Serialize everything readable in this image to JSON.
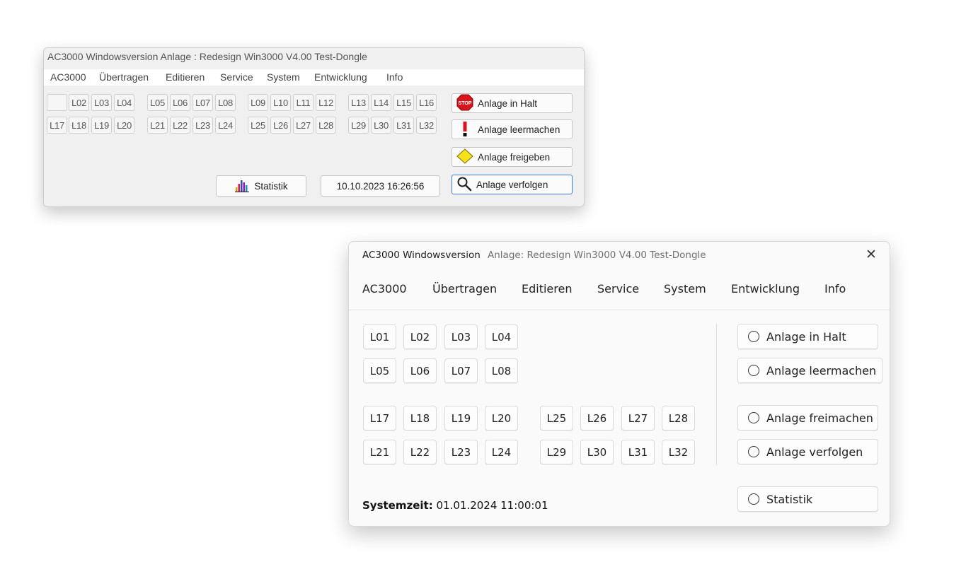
{
  "old_window": {
    "title": "AC3000 Windowsversion Anlage :  Redesign Win3000 V4.00 Test-Dongle",
    "menu": [
      "AC3000",
      "Übertragen",
      "Editieren",
      "Service",
      "System",
      "Entwicklung",
      "Info"
    ],
    "row1": [
      "",
      "L02",
      "L03",
      "L04",
      "L05",
      "L06",
      "L07",
      "L08",
      "L09",
      "L10",
      "L11",
      "L12",
      "L13",
      "L14",
      "L15",
      "L16"
    ],
    "row2": [
      "L17",
      "L18",
      "L19",
      "L20",
      "L21",
      "L22",
      "L23",
      "L24",
      "L25",
      "L26",
      "L27",
      "L28",
      "L29",
      "L30",
      "L31",
      "L32"
    ],
    "actions": {
      "halt": "Anlage in Halt",
      "empty": "Anlage leermachen",
      "release": "Anlage freigeben",
      "track": "Anlage verfolgen"
    },
    "stop_icon_text": "STOP",
    "stats_label": "Statistik",
    "datetime": "10.10.2023 16:26:56"
  },
  "new_window": {
    "app_name": "AC3000 Windowsversion",
    "doc_name": "Anlage: Redesign Win3000 V4.00 Test-Dongle",
    "close_glyph": "✕",
    "menu": [
      "AC3000",
      "Übertragen",
      "Editieren",
      "Service",
      "System",
      "Entwicklung",
      "Info"
    ],
    "block1_row1": [
      "L01",
      "L02",
      "L03",
      "L04"
    ],
    "block1_row2": [
      "L05",
      "L06",
      "L07",
      "L08"
    ],
    "block2_row1": [
      "L17",
      "L18",
      "L19",
      "L20"
    ],
    "block2_row2": [
      "L21",
      "L22",
      "L23",
      "L24"
    ],
    "block3_row1": [
      "L25",
      "L26",
      "L27",
      "L28"
    ],
    "block3_row2": [
      "L29",
      "L30",
      "L31",
      "L32"
    ],
    "actions": {
      "halt": "Anlage in Halt",
      "empty": "Anlage leermachen",
      "free": "Anlage freimachen",
      "track": "Anlage verfolgen",
      "stats": "Statistik"
    },
    "systime_label": "Systemzeit:",
    "systime_value": "01.01.2024 11:00:01"
  },
  "colors": {
    "stop_red": "#d8141c",
    "warning_yellow": "#f5e21a",
    "focus_blue": "#3b7ad6"
  },
  "icons": [
    "stop-sign-icon",
    "exclamation-icon",
    "yellow-diamond-icon",
    "magnifier-icon",
    "bar-chart-icon",
    "close-icon",
    "radio-icon"
  ]
}
